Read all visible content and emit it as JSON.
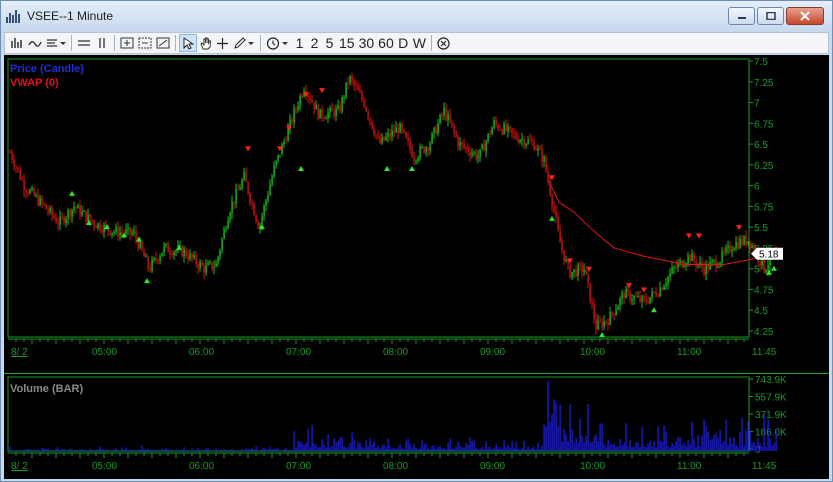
{
  "window": {
    "title": "VSEE--1 Minute"
  },
  "toolbar": {
    "intervals": [
      "1",
      "2",
      "5",
      "15",
      "30",
      "60",
      "D",
      "W"
    ]
  },
  "price_panel": {
    "legend": [
      {
        "label": "Price (Candle)",
        "color": "#1e2fd6"
      },
      {
        "label": "VWAP (0)",
        "color": "#e0141a"
      }
    ],
    "y_ticks": [
      "7.5",
      "7.25",
      "7",
      "6.75",
      "6.5",
      "6.25",
      "6",
      "5.75",
      "5.5",
      "5.25",
      "5",
      "4.75",
      "4.5",
      "4.25"
    ],
    "last_price": "5.18",
    "date_label": "8/ 2",
    "x_ticks": [
      "05:00",
      "06:00",
      "07:00",
      "08:00",
      "09:00",
      "10:00",
      "11:00",
      "11:45"
    ]
  },
  "volume_panel": {
    "legend": "Volume (BAR)",
    "y_ticks": [
      "743.9K",
      "557.9K",
      "371.9K",
      "186.0K",
      "0"
    ],
    "date_label": "8/ 2",
    "x_ticks": [
      "05:00",
      "06:00",
      "07:00",
      "08:00",
      "09:00",
      "10:00",
      "11:00",
      "11:45"
    ]
  },
  "colors": {
    "up": "#19c019",
    "down": "#d21414",
    "grid": "#0c5a1a",
    "axis": "#1a9a2a",
    "vwap": "#e0141a",
    "volume": "#2020e0"
  }
}
